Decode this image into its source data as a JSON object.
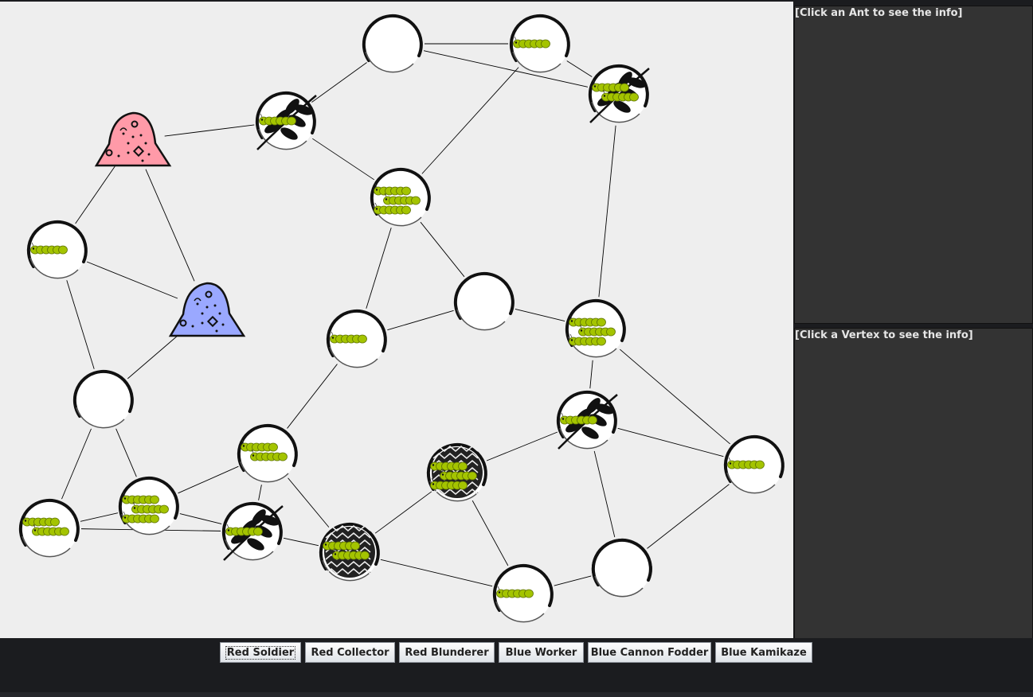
{
  "colors": {
    "board": "#eeeeee",
    "panel": "#333333",
    "red_colony": "#ff9aa8",
    "blue_colony": "#9aa8ff",
    "ant": "#a4c400"
  },
  "side_panels": {
    "ant_info": "[Click an Ant to see the info]",
    "vertex_info": "[Click a Vertex to see the info]"
  },
  "toolbar": {
    "buttons": [
      {
        "label": "Red Soldier",
        "focused": true
      },
      {
        "label": "Red Collector",
        "focused": false
      },
      {
        "label": "Red Blunderer",
        "focused": false
      },
      {
        "label": "Blue Worker",
        "focused": false
      },
      {
        "label": "Blue Cannon Fodder",
        "focused": false
      },
      {
        "label": "Blue Kamikaze",
        "focused": false
      }
    ]
  },
  "graph": {
    "vertices": [
      {
        "id": "v1",
        "type": "empty",
        "ants": 0
      },
      {
        "id": "v2",
        "type": "empty",
        "ants": 1
      },
      {
        "id": "v3",
        "type": "food",
        "ants": 2
      },
      {
        "id": "v4",
        "type": "food",
        "ants": 1
      },
      {
        "id": "v5",
        "type": "empty",
        "ants": 3
      },
      {
        "id": "v6",
        "type": "empty",
        "ants": 1
      },
      {
        "id": "v7",
        "type": "empty",
        "ants": 0
      },
      {
        "id": "v8",
        "type": "empty",
        "ants": 0
      },
      {
        "id": "v9",
        "type": "empty",
        "ants": 1
      },
      {
        "id": "v10",
        "type": "empty",
        "ants": 3
      },
      {
        "id": "v11",
        "type": "empty",
        "ants": 0
      },
      {
        "id": "v12",
        "type": "food",
        "ants": 1
      },
      {
        "id": "v13",
        "type": "empty",
        "ants": 2
      },
      {
        "id": "v14",
        "type": "rock",
        "ants": 3
      },
      {
        "id": "v15",
        "type": "empty",
        "ants": 1
      },
      {
        "id": "v16",
        "type": "empty",
        "ants": 2
      },
      {
        "id": "v17",
        "type": "empty",
        "ants": 3
      },
      {
        "id": "v18",
        "type": "food",
        "ants": 1
      },
      {
        "id": "v19",
        "type": "rock",
        "ants": 2
      },
      {
        "id": "v20",
        "type": "empty",
        "ants": 1
      },
      {
        "id": "v21",
        "type": "empty",
        "ants": 0
      }
    ],
    "colonies": [
      {
        "id": "red",
        "name": "Red colony"
      },
      {
        "id": "blue",
        "name": "Blue colony"
      }
    ]
  }
}
